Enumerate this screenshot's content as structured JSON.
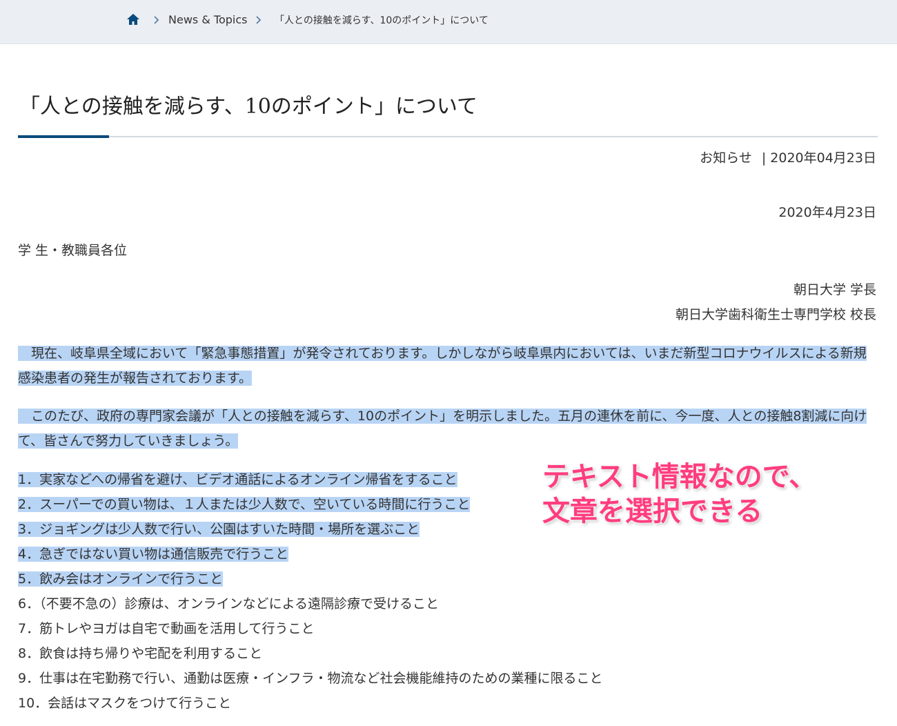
{
  "breadcrumb": {
    "home_icon": "home-icon",
    "separator_icon": "chevron-right-icon",
    "items": [
      "News & Topics",
      "「人との接触を減らす、10のポイント」について"
    ]
  },
  "article": {
    "title": "「人との接触を減らす、10のポイント」について",
    "category": "お知らせ",
    "meta_separator": "|",
    "published": "2020年04月23日",
    "letter_date": "2020年4月23日",
    "addressee": "学 生・教職員各位",
    "signatories": [
      "朝日大学 学長",
      "朝日大学歯科衛生士専門学校 校長"
    ],
    "paragraphs": [
      "　現在、岐阜県全域において「緊急事態措置」が発令されております。しかしながら岐阜県内においては、いまだ新型コロナウイルスによる新規感染患者の発生が報告されております。",
      "　このたび、政府の専門家会議が「人との接触を減らす、10のポイント」を明示しました。五月の連休を前に、今一度、人との接触8割減に向けて、皆さんで努力していきましょう。"
    ],
    "points": [
      "1．実家などへの帰省を避け、ビデオ通話によるオンライン帰省をすること",
      "2．スーパーでの買い物は、１人または少人数で、空いている時間に行うこと",
      "3．ジョギングは少人数で行い、公園はすいた時間・場所を選ぶこと",
      "4．急ぎではない買い物は通信販売で行うこと",
      "5．飲み会はオンラインで行うこと",
      "6．（不要不急の）診療は、オンラインなどによる遠隔診療で受けること",
      "7．筋トレやヨガは自宅で動画を活用して行うこと",
      "8．飲食は持ち帰りや宅配を利用すること",
      "9．仕事は在宅勤務で行い、通勤は医療・インフラ・物流など社会機能維持のための業種に限ること",
      "10．会話はマスクをつけて行うこと"
    ]
  },
  "annotation": {
    "lines": [
      "テキスト情報なので、",
      "文章を選択できる"
    ],
    "color": "#ff3d7f"
  },
  "colors": {
    "selection": "#b8d4f5",
    "accent": "#0a4a7c",
    "breadcrumb_bg": "#ebeef2"
  }
}
